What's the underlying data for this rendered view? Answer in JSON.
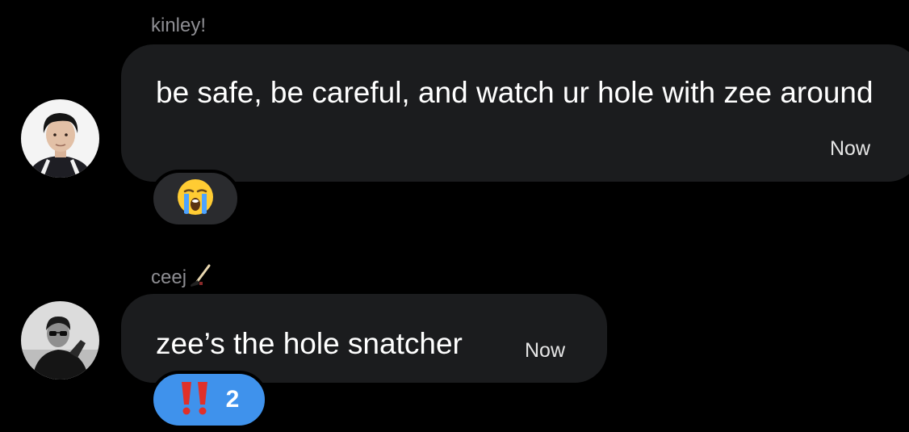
{
  "messages": [
    {
      "sender": "kinley!",
      "text": "be safe, be careful, and watch ur hole with zee around",
      "time": "Now",
      "reaction": {
        "emoji_icon": "loudly-crying-face-icon",
        "count": ""
      }
    },
    {
      "sender": "ceej",
      "sender_icon": "hockey-stick-icon",
      "text": "zee’s the hole snatcher",
      "time": "Now",
      "reaction": {
        "emoji_icon": "double-exclamation-icon",
        "count": "2"
      }
    }
  ],
  "colors": {
    "background": "#000000",
    "bubble": "#1b1c1e",
    "sender_name": "#8e8e93",
    "reaction_neutral": "#2a2b2e",
    "reaction_active": "#3f92ec"
  }
}
